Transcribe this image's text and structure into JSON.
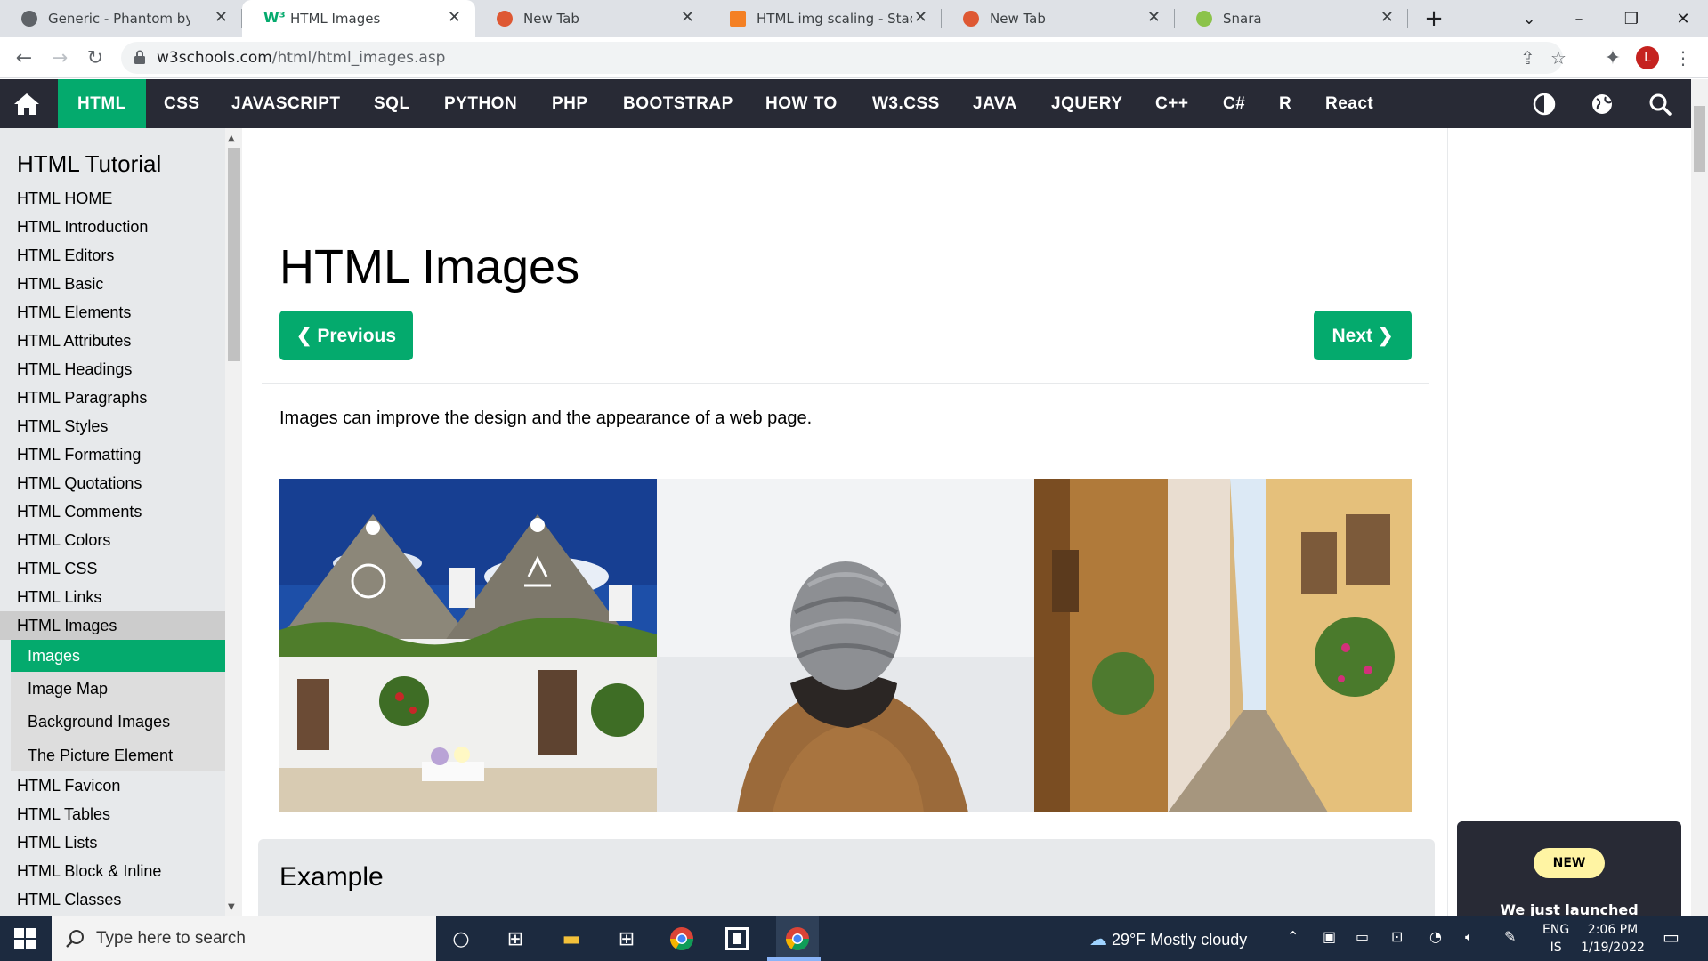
{
  "browser": {
    "tabs": [
      {
        "title": "Generic - Phantom by HTML",
        "favicon": "phantom-icon",
        "color": "#5f6368"
      },
      {
        "title": "HTML Images",
        "favicon": "w3schools-icon",
        "color": "#04aa6d"
      },
      {
        "title": "New Tab",
        "favicon": "duckduckgo-icon",
        "color": "#de5833"
      },
      {
        "title": "HTML img scaling - Stack O",
        "favicon": "stackoverflow-icon",
        "color": "#f48024"
      },
      {
        "title": "New Tab",
        "favicon": "duckduckgo-icon",
        "color": "#de5833"
      },
      {
        "title": "Snara",
        "favicon": "snara-icon",
        "color": "#8bc34a"
      }
    ],
    "url_host": "w3schools.com",
    "url_path": "/html/html_images.asp",
    "profile_initial": "L"
  },
  "topnav": {
    "items": [
      "HTML",
      "CSS",
      "JAVASCRIPT",
      "SQL",
      "PYTHON",
      "PHP",
      "BOOTSTRAP",
      "HOW TO",
      "W3.CSS",
      "JAVA",
      "JQUERY",
      "C++",
      "C#",
      "R",
      "React"
    ],
    "active": "HTML"
  },
  "sidebar": {
    "title": "HTML Tutorial",
    "links": [
      "HTML HOME",
      "HTML Introduction",
      "HTML Editors",
      "HTML Basic",
      "HTML Elements",
      "HTML Attributes",
      "HTML Headings",
      "HTML Paragraphs",
      "HTML Styles",
      "HTML Formatting",
      "HTML Quotations",
      "HTML Comments",
      "HTML Colors",
      "HTML CSS",
      "HTML Links",
      "HTML Images"
    ],
    "sub_links": [
      "Images",
      "Image Map",
      "Background Images",
      "The Picture Element"
    ],
    "links_after": [
      "HTML Favicon",
      "HTML Tables",
      "HTML Lists",
      "HTML Block & Inline",
      "HTML Classes"
    ]
  },
  "main": {
    "title": "HTML Images",
    "prev_label": "❮ Previous",
    "next_label": "Next ❯",
    "intro": "Images can improve the design and the appearance of a web page.",
    "example_heading": "Example"
  },
  "promo": {
    "badge": "NEW",
    "text": "We just launched"
  },
  "taskbar": {
    "search_placeholder": "Type here to search",
    "weather": "29°F  Mostly cloudy",
    "lang_top": "ENG",
    "lang_bottom": "IS",
    "time": "2:06 PM",
    "date": "1/19/2022"
  },
  "colors": {
    "accent": "#04aa6d",
    "nav_bg": "#282a35",
    "sidebar_bg": "#e7e9eb"
  }
}
